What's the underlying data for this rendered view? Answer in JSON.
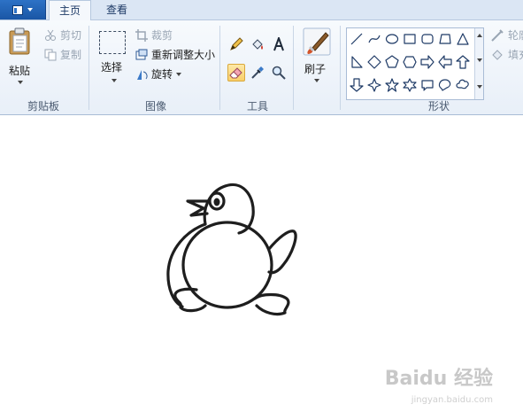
{
  "tabs": {
    "home": "主页",
    "view": "查看"
  },
  "clipboard": {
    "paste": "粘贴",
    "cut": "剪切",
    "copy": "复制",
    "group_label": "剪贴板"
  },
  "image": {
    "select": "选择",
    "crop": "裁剪",
    "resize": "重新调整大小",
    "rotate": "旋转",
    "group_label": "图像"
  },
  "tools": {
    "group_label": "工具",
    "active_tool": "eraser-icon",
    "items": [
      "pencil-icon",
      "fill-icon",
      "text-icon",
      "eraser-icon",
      "color-picker-icon",
      "magnifier-icon"
    ]
  },
  "brushes": {
    "label": "刷子"
  },
  "shapes": {
    "group_label": "形状",
    "outline": "轮廓",
    "fill": "填充",
    "items": [
      "line-icon",
      "curve-icon",
      "oval-icon",
      "rectangle-icon",
      "rounded-rectangle-icon",
      "polygon-icon",
      "triangle-icon",
      "right-triangle-icon",
      "diamond-icon",
      "pentagon-icon",
      "hexagon-icon",
      "right-arrow-icon",
      "left-arrow-icon",
      "up-arrow-icon",
      "down-arrow-icon",
      "four-point-star-icon",
      "five-point-star-icon",
      "six-point-star-icon",
      "rectangular-callout-icon",
      "oval-callout-icon",
      "cloud-callout-icon"
    ]
  },
  "watermark": {
    "brand": "Baidu 经验",
    "url": "jingyan.baidu.com"
  },
  "colors": {
    "ribbon_bg": "#eef3fa",
    "app_button": "#2d72c6",
    "active_tool": "#f9cf6a",
    "stroke": "#1e1e1e"
  }
}
